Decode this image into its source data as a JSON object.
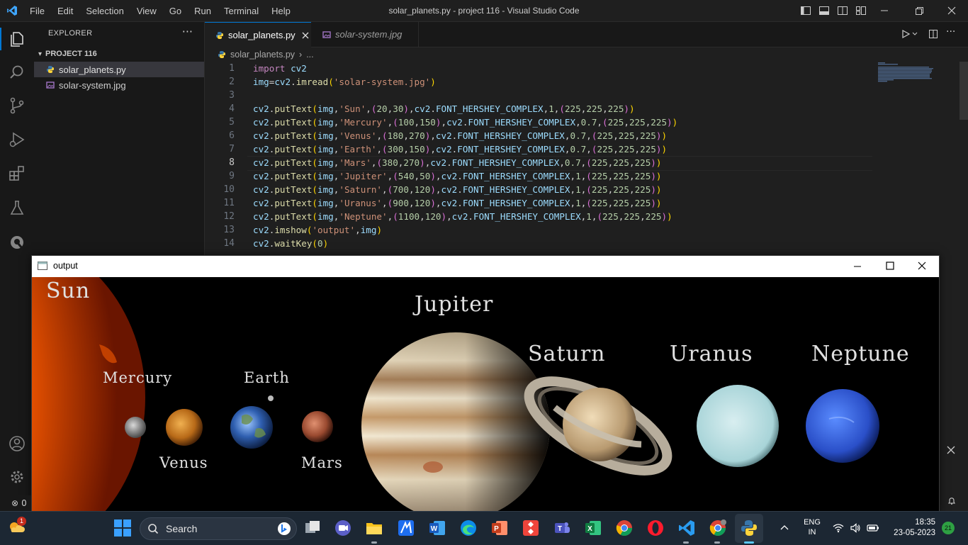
{
  "window": {
    "title": "solar_planets.py - project 116 - Visual Studio Code"
  },
  "menu": [
    "File",
    "Edit",
    "Selection",
    "View",
    "Go",
    "Run",
    "Terminal",
    "Help"
  ],
  "sidebar": {
    "title": "EXPLORER",
    "more": "···",
    "project": "PROJECT 116",
    "files": [
      {
        "name": "solar_planets.py",
        "icon": "python-file-icon",
        "selected": true
      },
      {
        "name": "solar-system.jpg",
        "icon": "image-file-icon",
        "selected": false
      }
    ]
  },
  "tabs": [
    {
      "label": "solar_planets.py",
      "active": true
    },
    {
      "label": "solar-system.jpg",
      "active": false
    }
  ],
  "breadcrumb": {
    "file": "solar_planets.py",
    "rest": "..."
  },
  "editor": {
    "active_line": 8,
    "lines": [
      {
        "n": "1",
        "text": "import cv2"
      },
      {
        "n": "2",
        "text": "img=cv2.imread('solar-system.jpg')"
      },
      {
        "n": "3",
        "text": ""
      },
      {
        "n": "4",
        "text": "cv2.putText(img,'Sun',(20,30),cv2.FONT_HERSHEY_COMPLEX,1,(225,225,225))"
      },
      {
        "n": "5",
        "text": "cv2.putText(img,'Mercury',(100,150),cv2.FONT_HERSHEY_COMPLEX,0.7,(225,225,225))"
      },
      {
        "n": "6",
        "text": "cv2.putText(img,'Venus',(180,270),cv2.FONT_HERSHEY_COMPLEX,0.7,(225,225,225))"
      },
      {
        "n": "7",
        "text": "cv2.putText(img,'Earth',(300,150),cv2.FONT_HERSHEY_COMPLEX,0.7,(225,225,225))"
      },
      {
        "n": "8",
        "text": "cv2.putText(img,'Mars',(380,270),cv2.FONT_HERSHEY_COMPLEX,0.7,(225,225,225))"
      },
      {
        "n": "9",
        "text": "cv2.putText(img,'Jupiter',(540,50),cv2.FONT_HERSHEY_COMPLEX,1,(225,225,225))"
      },
      {
        "n": "10",
        "text": "cv2.putText(img,'Saturn',(700,120),cv2.FONT_HERSHEY_COMPLEX,1,(225,225,225))"
      },
      {
        "n": "11",
        "text": "cv2.putText(img,'Uranus',(900,120),cv2.FONT_HERSHEY_COMPLEX,1,(225,225,225))"
      },
      {
        "n": "12",
        "text": "cv2.putText(img,'Neptune',(1100,120),cv2.FONT_HERSHEY_COMPLEX,1,(225,225,225))"
      },
      {
        "n": "13",
        "text": "cv2.imshow('output',img)"
      },
      {
        "n": "14",
        "text": "cv2.waitKey(0)"
      }
    ]
  },
  "output_window": {
    "title": "output",
    "labels": {
      "sun": "Sun",
      "mercury": "Mercury",
      "venus": "Venus",
      "earth": "Earth",
      "mars": "Mars",
      "jupiter": "Jupiter",
      "saturn": "Saturn",
      "uranus": "Uranus",
      "neptune": "Neptune"
    }
  },
  "status": {
    "problems": "0"
  },
  "taskbar": {
    "search_label": "Search",
    "weather_badge": "1",
    "lang_top": "ENG",
    "lang_bottom": "IN",
    "time": "18:35",
    "date": "23-05-2023",
    "notifications": "21",
    "apps": [
      "start-icon",
      "search",
      "task-view-icon",
      "teams-meet-icon",
      "file-explorer-icon",
      "app-icon",
      "word-icon",
      "edge-icon",
      "powerpoint-icon",
      "anydesk-icon",
      "teams-icon",
      "excel-icon",
      "chrome-icon",
      "opera-icon",
      "vscode-icon",
      "chrome-profile-icon",
      "python-icon"
    ]
  },
  "colors": {
    "accent": "#0078d4",
    "editor_bg": "#1f1f1f",
    "sidebar_bg": "#181818",
    "taskbar_bg": "#1c2733"
  }
}
